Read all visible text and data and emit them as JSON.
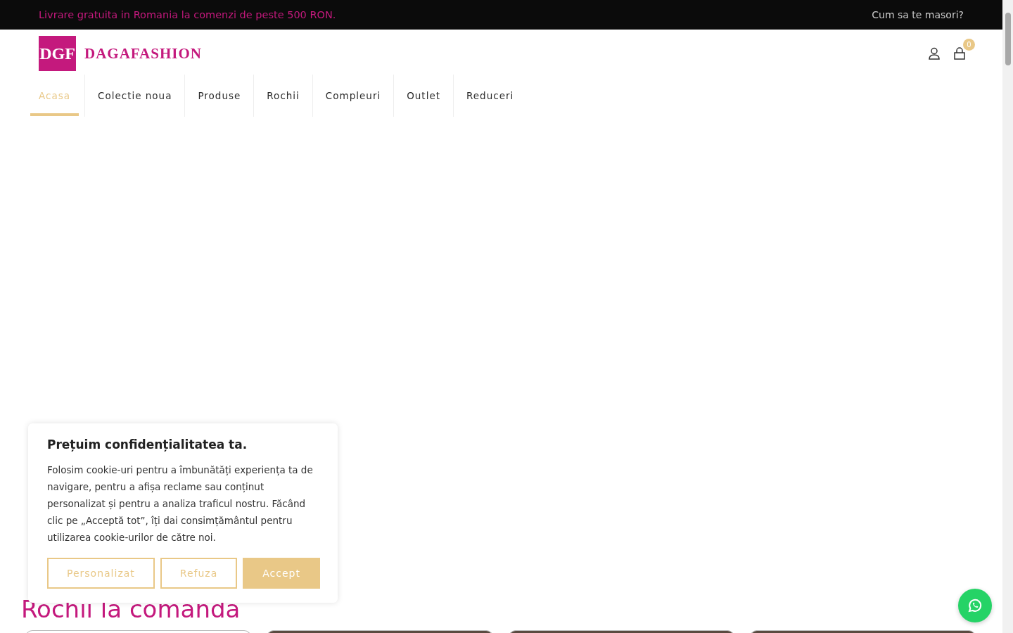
{
  "topbar": {
    "promo": "Livrare gratuita in Romania la comenzi de peste 500 RON.",
    "link": "Cum sa te masori?"
  },
  "header": {
    "logo_mark": "DGF",
    "logo_text": "DAGAFASHION",
    "cart_count": "0"
  },
  "nav": [
    {
      "label": "Acasa",
      "selected": true
    },
    {
      "label": "Colectie noua",
      "selected": false
    },
    {
      "label": "Produse",
      "selected": false
    },
    {
      "label": "Rochii",
      "selected": false
    },
    {
      "label": "Compleuri",
      "selected": false
    },
    {
      "label": "Outlet",
      "selected": false
    },
    {
      "label": "Reduceri",
      "selected": false
    }
  ],
  "section": {
    "title": "Rochii la comanda",
    "cards": [
      {
        "kind": "plain"
      },
      {
        "kind": "picture"
      },
      {
        "kind": "picture"
      },
      {
        "kind": "picture"
      }
    ]
  },
  "cookie_banner": {
    "title": "Prețuim confidențialitatea ta.",
    "text": "Folosim cookie-uri pentru a îmbunătăți experiența ta de navigare, pentru a afișa reclame sau conținut personalizat și pentru a analiza traficul nostru. Făcând clic pe „Acceptă tot”, îți dai consimțământul pentru utilizarea cookie-urilor de către noi.",
    "buttons": [
      {
        "label": "Personalizat",
        "kind": "outline"
      },
      {
        "label": "Refuza",
        "kind": "outline"
      },
      {
        "label": "Accept",
        "kind": "filled"
      }
    ]
  }
}
